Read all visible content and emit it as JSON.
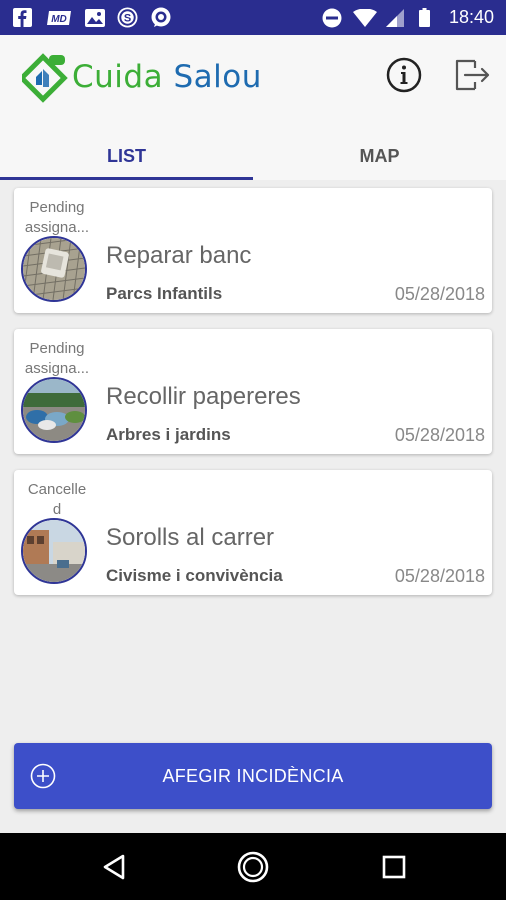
{
  "status_bar": {
    "time": "18:40",
    "left_icons": [
      "facebook-icon",
      "md-icon",
      "image-icon",
      "skype-icon",
      "chat-icon"
    ],
    "md_label": "MD",
    "right_icons": [
      "do-not-disturb-icon",
      "wifi-icon",
      "signal-icon",
      "battery-icon"
    ]
  },
  "app": {
    "logo_part1": "Cuida",
    "logo_part2": "Salou",
    "brand_green": "#3cae37",
    "brand_blue": "#1e6bb0",
    "accent": "#2f3596"
  },
  "tabs": [
    {
      "label": "LIST",
      "active": true
    },
    {
      "label": "MAP",
      "active": false
    }
  ],
  "incidents": [
    {
      "status_line1": "Pending",
      "status_line2": "assigna...",
      "title": "Reparar banc",
      "category": "Parcs Infantils",
      "date": "05/28/2018",
      "image": "bench-photo"
    },
    {
      "status_line1": "Pending",
      "status_line2": "assigna...",
      "title": "Recollir papereres",
      "category": "Arbres i jardins",
      "date": "05/28/2018",
      "image": "bins-photo"
    },
    {
      "status_line1": "Cancelle",
      "status_line2": "d",
      "title": "Sorolls al carrer",
      "category": "Civisme i convivència",
      "date": "05/28/2018",
      "image": "street-photo"
    }
  ],
  "add_button": {
    "label": "AFEGIR INCIDÈNCIA",
    "icon": "plus-circle-icon",
    "color": "#3d4fc9"
  },
  "nav_bar": {
    "buttons": [
      "back-icon",
      "home-icon",
      "recents-icon"
    ]
  }
}
